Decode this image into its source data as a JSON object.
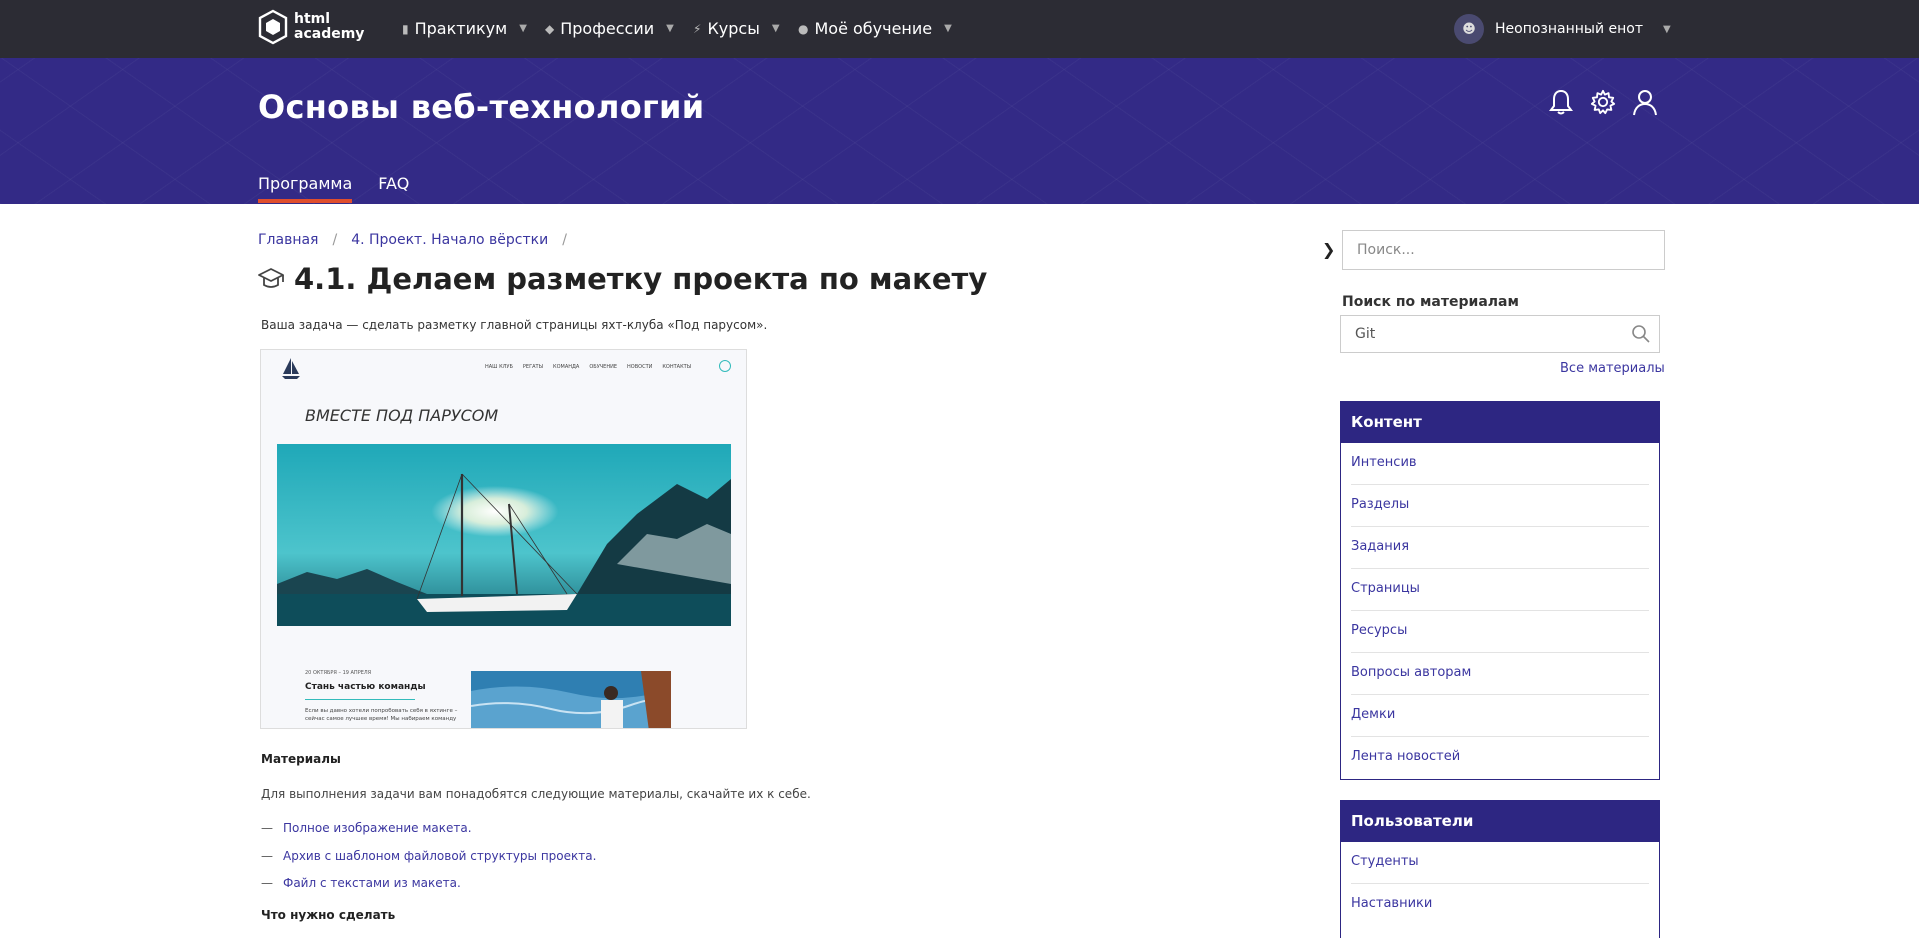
{
  "topnav": {
    "logo_line1": "html",
    "logo_line2": "academy",
    "items": [
      {
        "label": "Практикум",
        "icon": "bar-chart-icon"
      },
      {
        "label": "Профессии",
        "icon": "graduation-cap-icon"
      },
      {
        "label": "Курсы",
        "icon": "lightning-icon"
      },
      {
        "label": "Моё обучение",
        "icon": "people-icon"
      }
    ],
    "user_name": "Неопознанный енот"
  },
  "hero": {
    "title": "Основы веб-технологий",
    "icons": [
      "bell-icon",
      "gear-icon",
      "user-icon"
    ],
    "tabs": [
      {
        "label": "Программа",
        "active": true
      },
      {
        "label": "FAQ",
        "active": false
      }
    ]
  },
  "breadcrumb": [
    "Главная",
    "4. Проект. Начало вёрстки"
  ],
  "page": {
    "title": "4.1. Делаем разметку проекта по макету",
    "intro": "Ваша задача — сделать разметку главной страницы яхт-клуба «Под парусом».",
    "preview": {
      "nav": [
        "НАШ КЛУБ",
        "РЕГАТЫ",
        "КОМАНДА",
        "ОБУЧЕНИЕ",
        "НОВОСТИ",
        "КОНТАКТЫ"
      ],
      "title": "ВМЕСТЕ ПОД ПАРУСОМ",
      "date": "20 ОКТЯБРЯ – 19 АПРЕЛЯ",
      "subtitle": "Стань частью команды",
      "text": "Если вы давно хотели попробовать себя в яхтинге – сейчас самое лучшее время! Мы набираем команду"
    },
    "materials_title": "Материалы",
    "materials_desc": "Для выполнения задачи вам понадобятся следующие материалы, скачайте их к себе.",
    "materials": [
      "Полное изображение макета.",
      "Архив с шаблоном файловой структуры проекта.",
      "Файл с текстами из макета."
    ],
    "todo_title": "Что нужно сделать"
  },
  "sidebar": {
    "search_placeholder": "Поиск...",
    "materials_label": "Поиск по материалам",
    "materials_query": "Git",
    "all_materials": "Все материалы",
    "content_title": "Контент",
    "content_items": [
      "Интенсив",
      "Разделы",
      "Задания",
      "Страницы",
      "Ресурсы",
      "Вопросы авторам",
      "Демки",
      "Лента новостей"
    ],
    "users_title": "Пользователи",
    "users_items": [
      "Студенты",
      "Наставники"
    ]
  },
  "colors": {
    "topnav_bg": "#2c2c34",
    "hero_bg": "#332a86",
    "accent": "#e04e2c",
    "link": "#3b36a0",
    "panel_head": "#2d2682"
  }
}
